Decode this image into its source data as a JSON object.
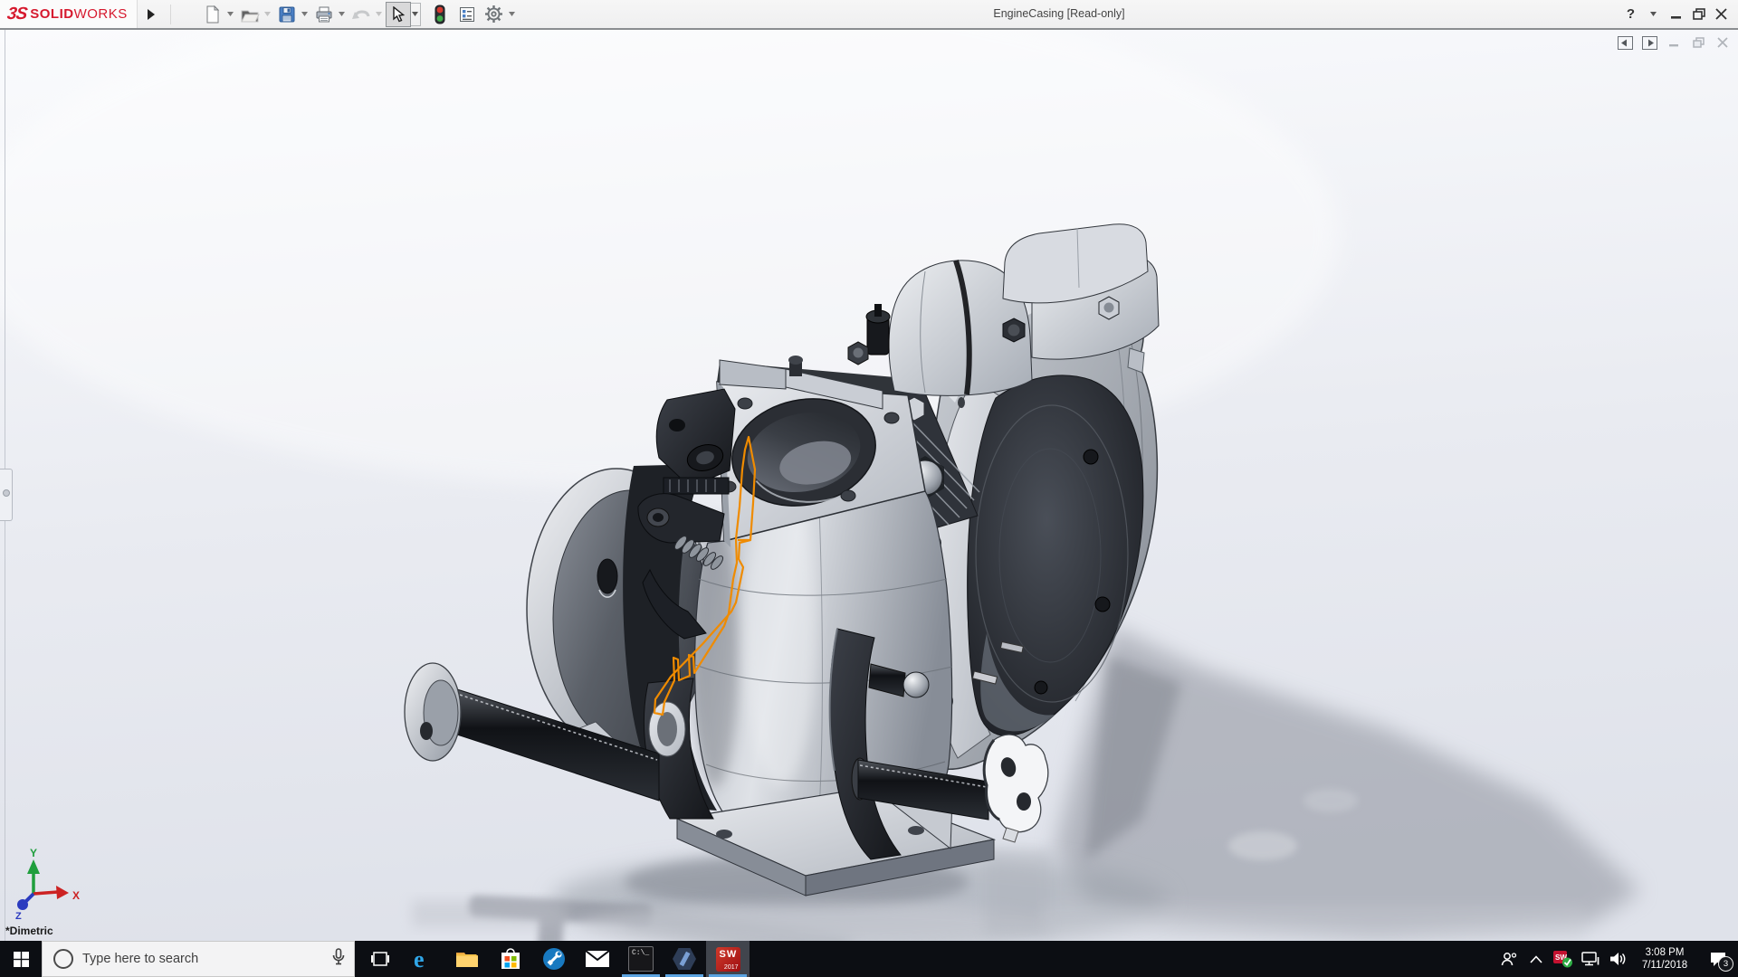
{
  "titlebar": {
    "brand_mark": "3S",
    "brand_bold": "SOLID",
    "brand_light": "WORKS",
    "title": "EngineCasing [Read-only]",
    "tools": [
      {
        "id": "new",
        "label": "New",
        "enabled": true,
        "has_dropdown": true
      },
      {
        "id": "open",
        "label": "Open",
        "enabled": false,
        "has_dropdown": true
      },
      {
        "id": "save",
        "label": "Save",
        "enabled": true,
        "has_dropdown": true
      },
      {
        "id": "print",
        "label": "Print",
        "enabled": true,
        "has_dropdown": true
      },
      {
        "id": "undo",
        "label": "Undo",
        "enabled": false,
        "has_dropdown": true
      },
      {
        "id": "select",
        "label": "Select",
        "enabled": true,
        "active": true,
        "has_dropdown": true
      },
      {
        "id": "rebuild",
        "label": "Rebuild",
        "enabled": true,
        "has_dropdown": false
      },
      {
        "id": "file-properties",
        "label": "File Properties",
        "enabled": true,
        "has_dropdown": false
      },
      {
        "id": "options",
        "label": "Options",
        "enabled": true,
        "has_dropdown": true
      }
    ],
    "window_controls": {
      "help": "?"
    }
  },
  "viewport": {
    "view_orientation": "*Dimetric",
    "triad": {
      "x_label": "X",
      "y_label": "Y",
      "z_label": "Z",
      "x_color": "#cc2222",
      "y_color": "#1f9e3d",
      "z_color": "#2b3bbf"
    },
    "model": {
      "name": "EngineCasing",
      "sketch_highlight_color": "#ef8b00"
    }
  },
  "taskbar": {
    "search": {
      "placeholder": "Type here to search"
    },
    "apps": [
      {
        "id": "task-view"
      },
      {
        "id": "edge"
      },
      {
        "id": "file-explorer"
      },
      {
        "id": "store"
      },
      {
        "id": "tools-app"
      },
      {
        "id": "mail"
      },
      {
        "id": "command-prompt",
        "running": true,
        "label": "C:\\_"
      },
      {
        "id": "hexagon-app",
        "running": true
      },
      {
        "id": "solidworks-2017",
        "running": true,
        "active": true,
        "label": "SW",
        "sub_label": "2017"
      }
    ],
    "tray": {
      "time": "3:08 PM",
      "date": "7/11/2018",
      "notification_count": "3"
    }
  },
  "colors": {
    "brand_red": "#d6192e",
    "sketch_orange": "#ef8b00",
    "taskbar_bg": "#0c0e13",
    "running_indicator": "#5ba3e0",
    "viewport_top": "#fafbfd",
    "viewport_bottom": "#dfe2ea"
  }
}
